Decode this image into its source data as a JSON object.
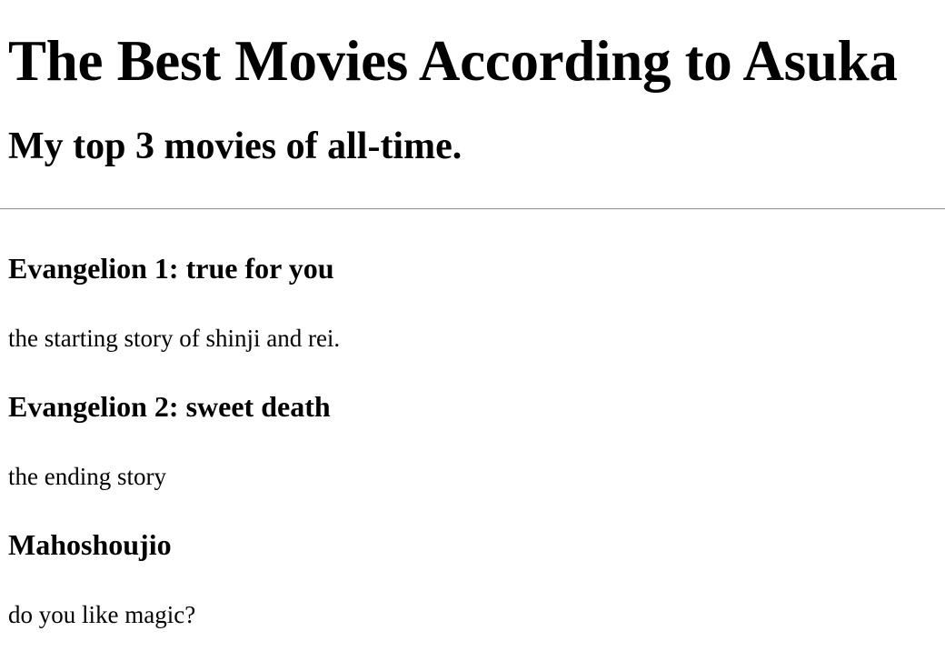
{
  "page": {
    "title": "The Best Movies According to Asuka",
    "subtitle": "My top 3 movies of all-time."
  },
  "movies": [
    {
      "title": "Evangelion 1: true for you",
      "description": "the starting story of shinji and rei."
    },
    {
      "title": "Evangelion 2: sweet death",
      "description": "the ending story"
    },
    {
      "title": "Mahoshoujio",
      "description": "do you like magic?"
    }
  ]
}
